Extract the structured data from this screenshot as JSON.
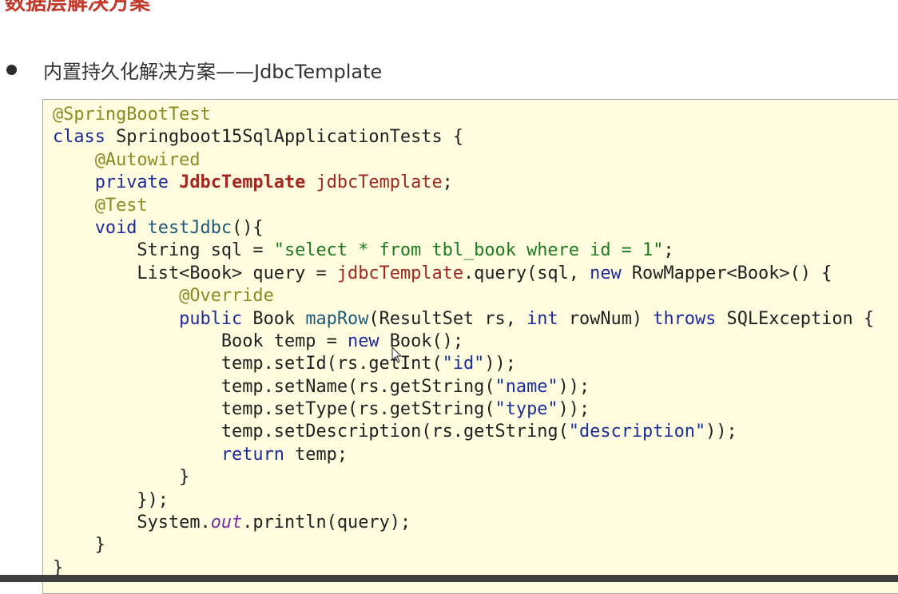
{
  "slide": {
    "title": "数据层解决方案",
    "bullet": "内置持久化解决方案——JdbcTemplate"
  },
  "code": {
    "lines": [
      [
        {
          "t": "@SpringBootTest",
          "c": "ann"
        }
      ],
      [
        {
          "t": "class",
          "c": "kw"
        },
        {
          "t": " Springboot15SqlApplicationTests {",
          "c": "pl"
        }
      ],
      [
        {
          "t": "    ",
          "c": "pl"
        },
        {
          "t": "@Autowired",
          "c": "ann"
        }
      ],
      [
        {
          "t": "    ",
          "c": "pl"
        },
        {
          "t": "private",
          "c": "kw"
        },
        {
          "t": " ",
          "c": "pl"
        },
        {
          "t": "JdbcTemplate",
          "c": "type"
        },
        {
          "t": " ",
          "c": "pl"
        },
        {
          "t": "jdbcTemplate",
          "c": "fld"
        },
        {
          "t": ";",
          "c": "pl"
        }
      ],
      [
        {
          "t": "    ",
          "c": "pl"
        },
        {
          "t": "@Test",
          "c": "ann"
        }
      ],
      [
        {
          "t": "    ",
          "c": "pl"
        },
        {
          "t": "void",
          "c": "kw"
        },
        {
          "t": " ",
          "c": "pl"
        },
        {
          "t": "testJdbc",
          "c": "mth"
        },
        {
          "t": "(){",
          "c": "pl"
        }
      ],
      [
        {
          "t": "        String sql = ",
          "c": "pl"
        },
        {
          "t": "\"select * from tbl_book where id = 1\"",
          "c": "str"
        },
        {
          "t": ";",
          "c": "pl"
        }
      ],
      [
        {
          "t": "        List<Book> query = ",
          "c": "pl"
        },
        {
          "t": "jdbcTemplate",
          "c": "fld"
        },
        {
          "t": ".query(sql, ",
          "c": "pl"
        },
        {
          "t": "new",
          "c": "kw"
        },
        {
          "t": " RowMapper<Book>() {",
          "c": "pl"
        }
      ],
      [
        {
          "t": "            ",
          "c": "pl"
        },
        {
          "t": "@Override",
          "c": "ann"
        }
      ],
      [
        {
          "t": "            ",
          "c": "pl"
        },
        {
          "t": "public",
          "c": "kw"
        },
        {
          "t": " Book ",
          "c": "pl"
        },
        {
          "t": "mapRow",
          "c": "mth"
        },
        {
          "t": "(ResultSet rs, ",
          "c": "pl"
        },
        {
          "t": "int",
          "c": "kw"
        },
        {
          "t": " rowNum) ",
          "c": "pl"
        },
        {
          "t": "throws",
          "c": "kw"
        },
        {
          "t": " SQLException {",
          "c": "pl"
        }
      ],
      [
        {
          "t": "                Book temp = ",
          "c": "pl"
        },
        {
          "t": "new",
          "c": "kw"
        },
        {
          "t": " Book();",
          "c": "pl"
        }
      ],
      [
        {
          "t": "                temp.setId(rs.getInt(",
          "c": "pl"
        },
        {
          "t": "\"id\"",
          "c": "str-d"
        },
        {
          "t": "));",
          "c": "pl"
        }
      ],
      [
        {
          "t": "                temp.setName(rs.getString(",
          "c": "pl"
        },
        {
          "t": "\"name\"",
          "c": "str-d"
        },
        {
          "t": "));",
          "c": "pl"
        }
      ],
      [
        {
          "t": "                temp.setType(rs.getString(",
          "c": "pl"
        },
        {
          "t": "\"type\"",
          "c": "str-d"
        },
        {
          "t": "));",
          "c": "pl"
        }
      ],
      [
        {
          "t": "                temp.setDescription(rs.getString(",
          "c": "pl"
        },
        {
          "t": "\"description\"",
          "c": "str-d"
        },
        {
          "t": "));",
          "c": "pl"
        }
      ],
      [
        {
          "t": "                ",
          "c": "pl"
        },
        {
          "t": "return",
          "c": "kw"
        },
        {
          "t": " temp;",
          "c": "pl"
        }
      ],
      [
        {
          "t": "            }",
          "c": "pl"
        }
      ],
      [
        {
          "t": "        });",
          "c": "pl"
        }
      ],
      [
        {
          "t": "        System.",
          "c": "pl"
        },
        {
          "t": "out",
          "c": "stat"
        },
        {
          "t": ".println(query);",
          "c": "pl"
        }
      ],
      [
        {
          "t": "    }",
          "c": "pl"
        }
      ],
      [
        {
          "t": "}",
          "c": "pl"
        }
      ]
    ]
  },
  "colors": {
    "title": "#c0392b",
    "keyword": "#1f2a9a",
    "annotation": "#8d8a24",
    "type_bold": "#a3261f",
    "string": "#1f7a1f",
    "code_background": "#fffde0"
  },
  "icons": {
    "bullet": "bullet-dot-icon",
    "pointer": "mouse-cursor-icon"
  }
}
